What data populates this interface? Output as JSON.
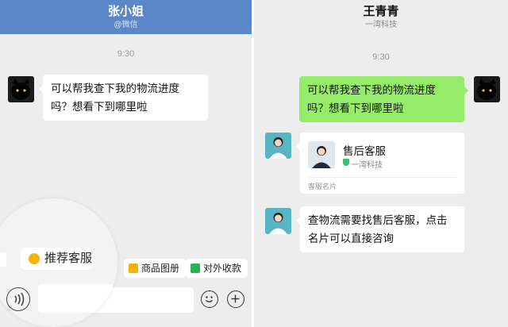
{
  "left": {
    "header": {
      "title": "张小姐",
      "subtitle": "@微信"
    },
    "time": "9:30",
    "message": "可以帮我查下我的物流进度吗？想看下到哪里啦",
    "quick_replies": [
      {
        "label": "推荐客服",
        "icon": "smile-icon",
        "color": "#f5b400"
      },
      {
        "label": "商品图册",
        "icon": "catalog-icon",
        "color": "#f5b400"
      },
      {
        "label": "对外收款",
        "icon": "payment-icon",
        "color": "#2bb15b"
      }
    ]
  },
  "right": {
    "header": {
      "title": "王青青",
      "subtitle": "一湾科技"
    },
    "time": "9:30",
    "message_sent": "可以帮我查下我的物流进度吗？想看下到哪里啦",
    "card": {
      "name": "售后客服",
      "org": "一湾科技",
      "footer": "客服名片"
    },
    "reply": "查物流需要找售后客服，点击名片可以直接咨询"
  },
  "colors": {
    "header_blue": "#5b87c7",
    "sent_bubble": "#95ec69",
    "chat_bg": "#ededed"
  }
}
